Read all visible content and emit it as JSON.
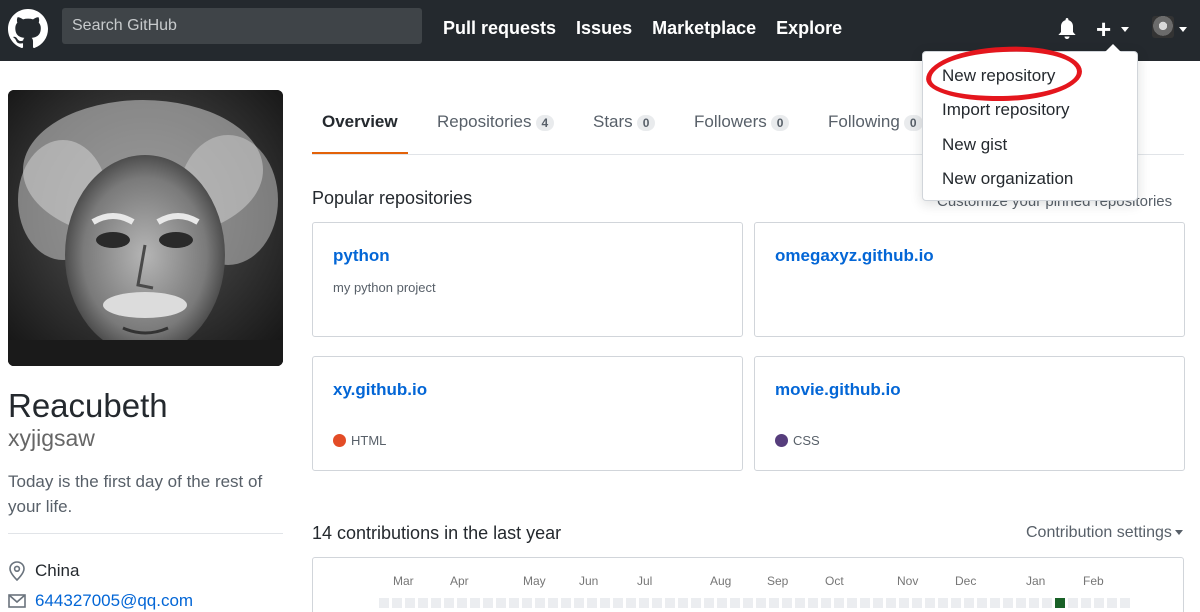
{
  "header": {
    "search_placeholder": "Search GitHub",
    "nav": [
      "Pull requests",
      "Issues",
      "Marketplace",
      "Explore"
    ]
  },
  "dropdown": {
    "items": [
      "New repository",
      "Import repository",
      "New gist",
      "New organization"
    ]
  },
  "profile": {
    "fullname": "Reacubeth",
    "username": "xyjigsaw",
    "bio": "Today is the first day of the rest of your life.",
    "location": "China",
    "email": "644327005@qq.com"
  },
  "tabs": [
    {
      "label": "Overview",
      "count": null
    },
    {
      "label": "Repositories",
      "count": "4"
    },
    {
      "label": "Stars",
      "count": "0"
    },
    {
      "label": "Followers",
      "count": "0"
    },
    {
      "label": "Following",
      "count": "0"
    }
  ],
  "popular": {
    "title": "Popular repositories",
    "customize": "Customize your pinned repositories"
  },
  "repos": [
    {
      "name": "python",
      "description": "my python project",
      "language": "",
      "language_color": ""
    },
    {
      "name": "omegaxyz.github.io",
      "description": "",
      "language": "",
      "language_color": ""
    },
    {
      "name": "xy.github.io",
      "description": "",
      "language": "HTML",
      "language_color": "#e34c26"
    },
    {
      "name": "movie.github.io",
      "description": "",
      "language": "CSS",
      "language_color": "#563d7c"
    }
  ],
  "contributions": {
    "title": "14 contributions in the last year",
    "settings": "Contribution settings",
    "months": [
      "Mar",
      "Apr",
      "May",
      "Jun",
      "Jul",
      "Aug",
      "Sep",
      "Oct",
      "Nov",
      "Dec",
      "Jan",
      "Feb"
    ]
  },
  "colors": {
    "header_bg": "#24292e",
    "link": "#0366d6",
    "tab_accent": "#e36209",
    "annotation_red": "#e4161d",
    "contribution_active": "#196127"
  }
}
